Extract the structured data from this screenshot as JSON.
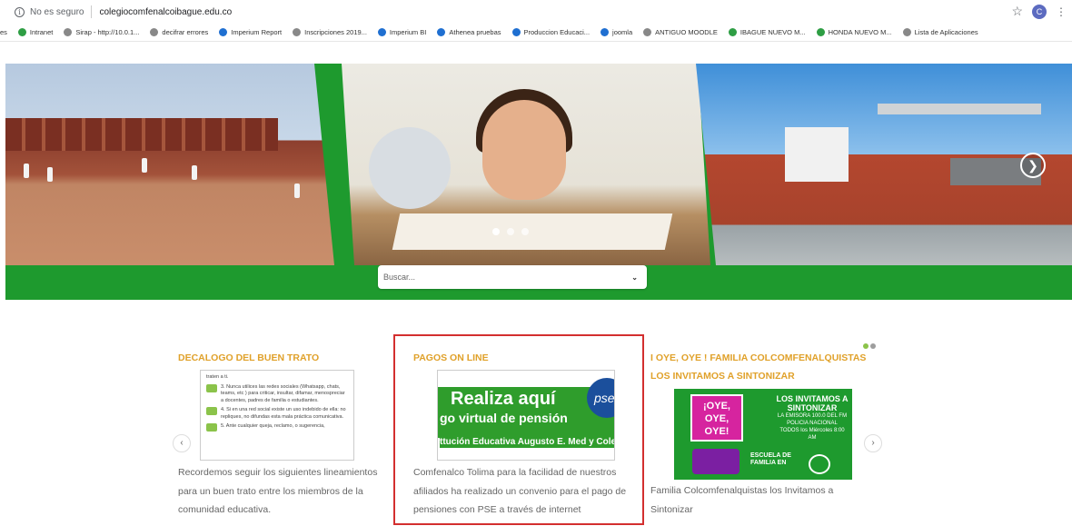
{
  "browser": {
    "security_label": "No es seguro",
    "url": "colegiocomfenalcoibague.edu.co",
    "star_icon": "star-icon",
    "profile_initial": "C",
    "menu_icon": "more-vert-icon"
  },
  "bookmarks": [
    {
      "label": "es",
      "icon": "none"
    },
    {
      "label": "Intranet",
      "icon": "green"
    },
    {
      "label": "Sirap - http://10.0.1...",
      "icon": "grey"
    },
    {
      "label": "decifrar errores",
      "icon": "grey"
    },
    {
      "label": "Imperium Report",
      "icon": "blue"
    },
    {
      "label": "Inscripciones 2019...",
      "icon": "grey"
    },
    {
      "label": "Imperium BI",
      "icon": "blue"
    },
    {
      "label": "Athenea pruebas",
      "icon": "blue"
    },
    {
      "label": "Produccion Educaci...",
      "icon": "blue"
    },
    {
      "label": "joomla",
      "icon": "blue"
    },
    {
      "label": "ANTIGUO MOODLE",
      "icon": "grey"
    },
    {
      "label": "IBAGUE NUEVO M...",
      "icon": "green"
    },
    {
      "label": "HONDA NUEVO M...",
      "icon": "green"
    },
    {
      "label": "Lista de Aplicaciones",
      "icon": "grey"
    }
  ],
  "hero": {
    "slide_count": 3,
    "active_slide": 1
  },
  "search": {
    "placeholder": "Buscar..."
  },
  "cards": {
    "decalogo": {
      "title": "DECALOGO DEL BUEN TRATO",
      "thumb_lines": [
        "traten a ti.",
        "3. Nunca utilices las redes sociales (Whatsapp, chats, teams, etc ) para criticar, insultar, difamar, menospreciar a docentes, padres de familia o estudiantes.",
        "4. Si en una red social existe un uso indebido de ella: no repliques, no difundas esta mala práctica comunicativa.",
        "5. Ante cualquier queja, reclamo, o sugerencia,"
      ],
      "text": "Recordemos seguir los siguientes lineamientos para un buen trato entre los miembros de la comunidad educativa."
    },
    "pagos": {
      "title": "PAGOS ON LINE",
      "thumb_l1": "Realiza aquí",
      "thumb_l2": "go virtual de pensión",
      "thumb_l3": "ttución Educativa Augusto E. Med y Colegio Honda",
      "thumb_logo": "pse",
      "text": "Comfenalco Tolima para la facilidad de nuestros afiliados ha realizado un convenio para el pago de pensiones con PSE a través de internet"
    },
    "oye": {
      "title": "I OYE, OYE ! FAMILIA COLCOMFENALQUISTAS LOS INVITAMOS A SINTONIZAR",
      "thumb_speech": "¡OYE, OYE, OYE!",
      "thumb_head": "LOS INVITAMOS A SINTONIZAR",
      "thumb_sub": "LA EMISORA 100.0 DEL FM POLICIA NACIONAL",
      "thumb_sub2": "TODOS los Miércoles 8:00 AM",
      "thumb_escuela": "ESCUELA DE FAMILIA EN",
      "text": "Familia Colcomfenalquistas los Invitamos a Sintonizar"
    }
  },
  "carousel": {
    "prev_icon": "chevron-left-icon",
    "next_icon": "chevron-right-icon"
  }
}
